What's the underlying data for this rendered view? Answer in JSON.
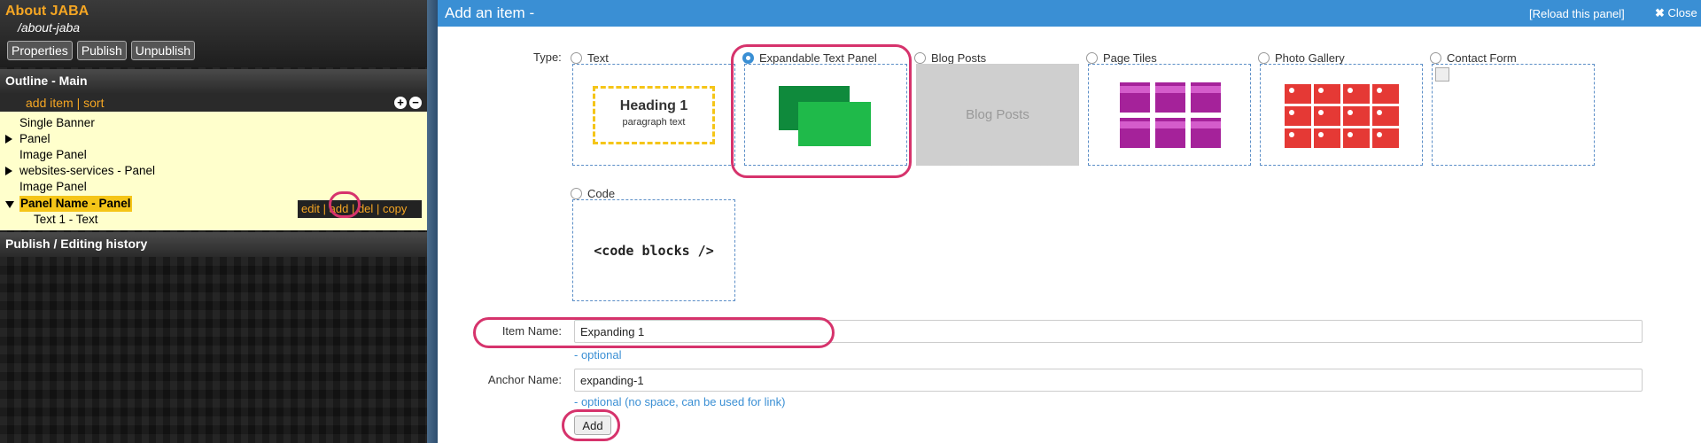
{
  "left": {
    "page_title": "About JABA",
    "page_path": "/about-jaba",
    "buttons": [
      "Properties",
      "Publish",
      "Unpublish"
    ],
    "outline_title": "Outline - Main",
    "add_item": "add item",
    "sort": "sort",
    "link_sep": "|",
    "plus": "+",
    "minus": "−",
    "tree": [
      {
        "label": "Single Banner",
        "arrow": "none"
      },
      {
        "label": "Panel",
        "arrow": "right"
      },
      {
        "label": "Image Panel",
        "arrow": "none"
      },
      {
        "label": "websites-services - Panel",
        "arrow": "right"
      },
      {
        "label": "Image Panel",
        "arrow": "none"
      },
      {
        "label": "Panel Name - Panel",
        "arrow": "down",
        "selected": true
      },
      {
        "label": "Text 1 - Text",
        "arrow": "none",
        "child": true
      }
    ],
    "row_actions": {
      "edit": "edit",
      "add": "add",
      "del": "del",
      "copy": "copy"
    },
    "history_title": "Publish / Editing history"
  },
  "dialog": {
    "title": "Add an item -",
    "reload": "[Reload this panel]",
    "close": "Close",
    "type_label": "Type:",
    "types": [
      {
        "label": "Text",
        "thumb_heading": "Heading 1",
        "thumb_sub": "paragraph text"
      },
      {
        "label": "Expandable Text Panel",
        "checked": true
      },
      {
        "label": "Blog Posts",
        "thumb_text": "Blog Posts"
      },
      {
        "label": "Page Tiles"
      },
      {
        "label": "Photo Gallery"
      },
      {
        "label": "Contact Form"
      },
      {
        "label": "Code",
        "thumb_text": "<code blocks />"
      }
    ],
    "item_name_label": "Item Name:",
    "item_name_value": "Expanding 1",
    "item_name_hint": "- optional",
    "anchor_label": "Anchor Name:",
    "anchor_value": "expanding-1",
    "anchor_hint": "- optional (no space, can be used for link)",
    "add_button": "Add"
  },
  "colors": {
    "accent": "#3a8fd4",
    "highlight": "#d6336c",
    "orange": "#f5a623",
    "tree_bg": "#ffffcc"
  }
}
